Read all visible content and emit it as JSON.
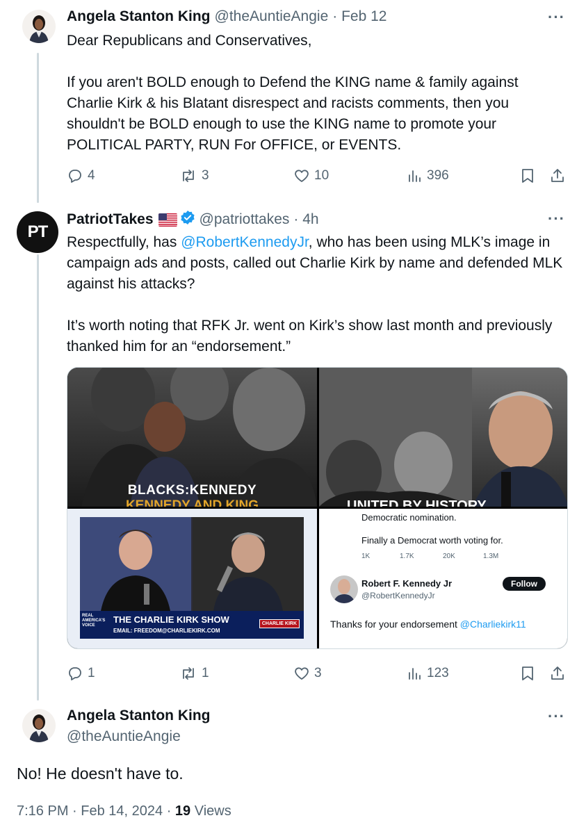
{
  "tweet1": {
    "author_name": "Angela Stanton King",
    "author_handle": "@theAuntieAngie",
    "date": "· Feb 12",
    "text": "Dear Republicans and Conservatives,\n\nIf you aren't BOLD enough to Defend the KING name & family against Charlie Kirk & his Blatant disrespect and racists comments, then you shouldn't be BOLD enough to use the KING name to promote your POLITICAL PARTY, RUN For OFFICE, or EVENTS.",
    "replies": "4",
    "reposts": "3",
    "likes": "10",
    "views": "396"
  },
  "tweet2": {
    "author_name": "PatriotTakes",
    "author_handle": "@patriottakes",
    "date": "· 4h",
    "avatar_text": "PT",
    "text_before": "Respectfully, has ",
    "mention": "@RobertKennedyJr",
    "text_after": ", who has been using MLK’s image in campaign ads and posts, called out Charlie Kirk by name and defended MLK against his attacks?\n\nIt’s worth noting that RFK Jr. went on Kirk’s show last month and previously thanked him for an “endorsement.”",
    "replies": "1",
    "reposts": "1",
    "likes": "3",
    "views": "123",
    "media": {
      "q1_caption": "BLACKS:KENNEDY",
      "q1_caption2": "KENNEDY AND KING",
      "q2_caption": "UNITED BY HISTORY",
      "q3_show_title": "THE CHARLIE KIRK SHOW",
      "q3_show_email": "EMAIL: FREEDOM@CHARLIEKIRK.COM",
      "q3_badge": "REAL AMERICA'S VOICE",
      "q3_logo": "CHARLIE KIRK",
      "q4": {
        "line1": "Democratic nomination.",
        "line2": "Finally a Democrat worth voting for.",
        "replies": "1K",
        "reposts": "1.7K",
        "likes": "20K",
        "views": "1.3M",
        "name": "Robert F. Kennedy Jr",
        "handle": "@RobertKennedyJr",
        "follow": "Follow",
        "reply_text": "Thanks for your endorsement ",
        "reply_mention": "@Charliekirk11"
      }
    }
  },
  "tweet3": {
    "author_name": "Angela Stanton King",
    "author_handle": "@theAuntieAngie",
    "text": "No! He doesn't have to.",
    "time": "7:16 PM",
    "date": "Feb 14, 2024",
    "views_count": "19",
    "views_label": "Views"
  },
  "more_icon": "···",
  "colors": {
    "accent": "#1d9bf0",
    "muted": "#536471",
    "line": "#cfd9de"
  }
}
